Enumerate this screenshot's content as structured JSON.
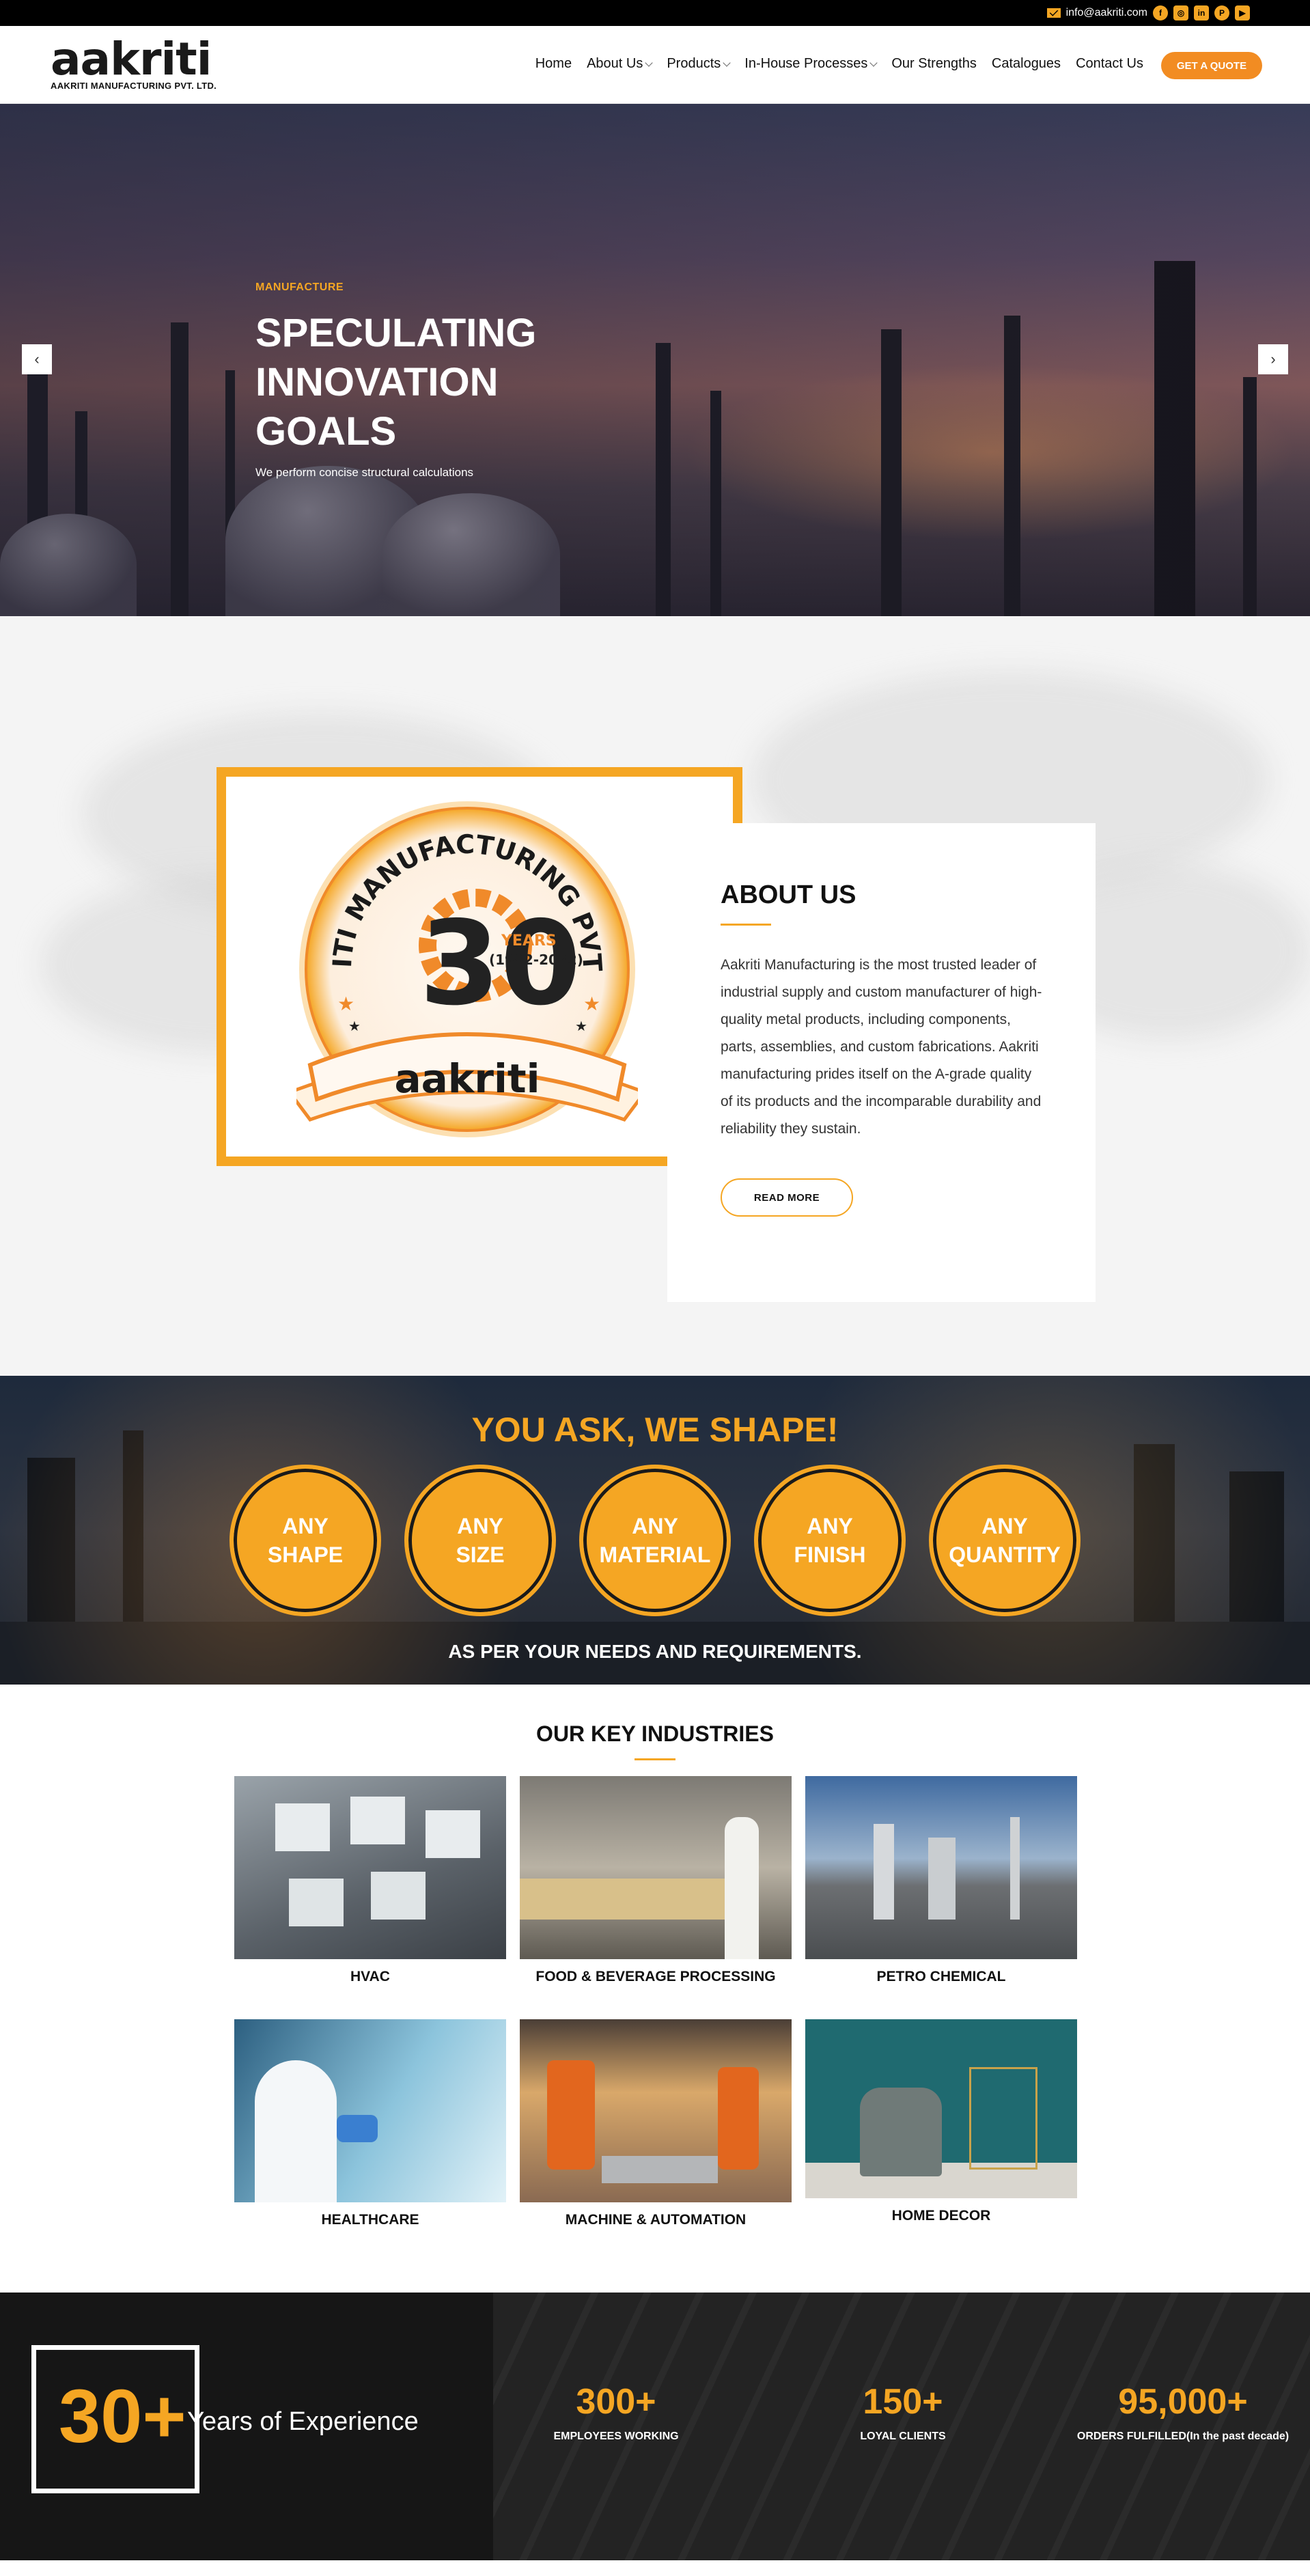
{
  "topbar": {
    "email": "info@aakriti.com",
    "icons": [
      "mail-icon",
      "facebook-icon",
      "instagram-icon",
      "linkedin-icon",
      "pinterest-icon",
      "youtube-icon"
    ]
  },
  "header": {
    "logo_word": "aakriti",
    "logo_sub": "AAKRITI MANUFACTURING PVT. LTD.",
    "nav": [
      {
        "label": "Home",
        "dropdown": false
      },
      {
        "label": "About Us",
        "dropdown": true
      },
      {
        "label": "Products",
        "dropdown": true
      },
      {
        "label": "In-House Processes",
        "dropdown": true
      },
      {
        "label": "Our Strengths",
        "dropdown": false
      },
      {
        "label": "Catalogues",
        "dropdown": false
      },
      {
        "label": "Contact Us",
        "dropdown": false
      }
    ],
    "quote_button": "GET A QUOTE"
  },
  "hero": {
    "kicker": "MANUFACTURE",
    "title": "SPECULATING INNOVATION GOALS",
    "subtitle": "We perform concise structural calculations",
    "prev_icon": "chevron-left-icon",
    "next_icon": "chevron-right-icon"
  },
  "about": {
    "badge": {
      "arc_text": "AAKRITI MANUFACTURING PVT. LTD.",
      "number": "30",
      "years": "YEARS",
      "range": "(1992-2022)",
      "ribbon": "aakriti"
    },
    "title": "ABOUT US",
    "text": "Aakriti Manufacturing is the most trusted leader of industrial supply and custom manufacturer of high-quality metal products, including components, parts, assemblies, and custom fabrications. Aakriti manufacturing prides itself on the A-grade quality of its products and the incomparable durability and reliability they sustain.",
    "button": "READ MORE"
  },
  "shape": {
    "title": "YOU ASK, WE SHAPE!",
    "circles": [
      {
        "line1": "ANY",
        "line2": "SHAPE"
      },
      {
        "line1": "ANY",
        "line2": "SIZE"
      },
      {
        "line1": "ANY",
        "line2": "MATERIAL"
      },
      {
        "line1": "ANY",
        "line2": "FINISH"
      },
      {
        "line1": "ANY",
        "line2": "QUANTITY"
      }
    ],
    "footer": "AS PER YOUR NEEDS AND REQUIREMENTS."
  },
  "industries": {
    "title": "OUR KEY INDUSTRIES",
    "items": [
      {
        "label": "HVAC"
      },
      {
        "label": "FOOD & BEVERAGE PROCESSING"
      },
      {
        "label": "PETRO CHEMICAL"
      },
      {
        "label": "HEALTHCARE"
      },
      {
        "label": "MACHINE & AUTOMATION"
      },
      {
        "label": "HOME DECOR"
      }
    ]
  },
  "stats": {
    "experience_number": "30+",
    "experience_label": "Years of Experience",
    "items": [
      {
        "number": "300+",
        "label": "EMPLOYEES WORKING"
      },
      {
        "number": "150+",
        "label": "LOYAL CLIENTS"
      },
      {
        "number": "95,000+",
        "label": "ORDERS FULFILLED(In the past decade)"
      }
    ]
  },
  "colors": {
    "accent": "#f5a623",
    "button": "#f28c22",
    "dark": "#161616"
  }
}
